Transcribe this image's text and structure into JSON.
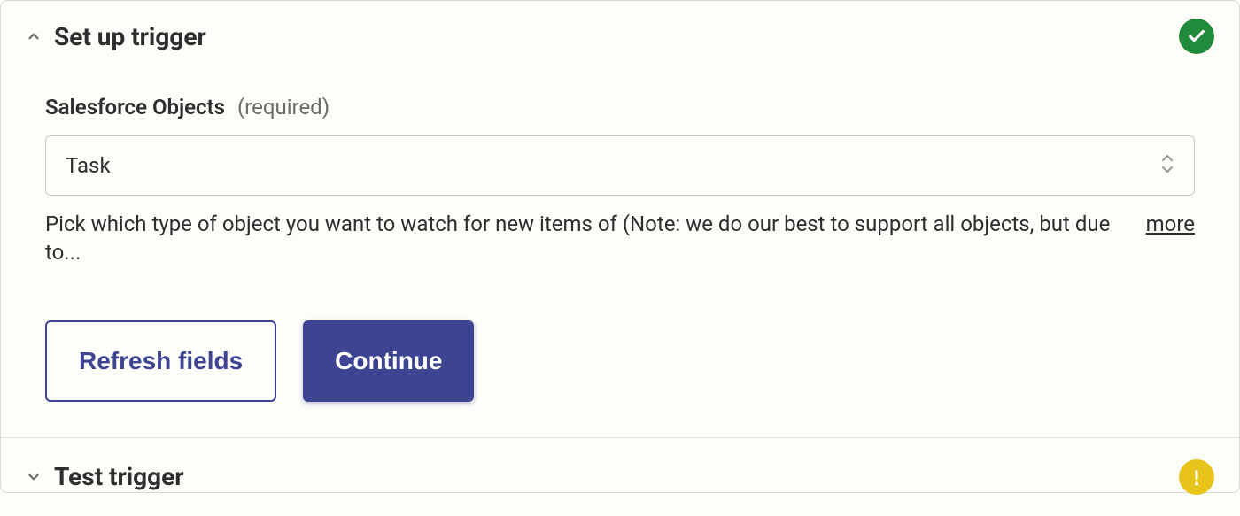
{
  "setup": {
    "title": "Set up trigger",
    "status": "success",
    "field": {
      "label": "Salesforce Objects",
      "required_label": "(required)",
      "value": "Task",
      "help": "Pick which type of object you want to watch for new items of (Note: we do our best to support all objects, but due to...",
      "more_label": "more"
    },
    "buttons": {
      "refresh": "Refresh fields",
      "continue": "Continue"
    }
  },
  "test": {
    "title": "Test trigger",
    "status": "warning"
  }
}
